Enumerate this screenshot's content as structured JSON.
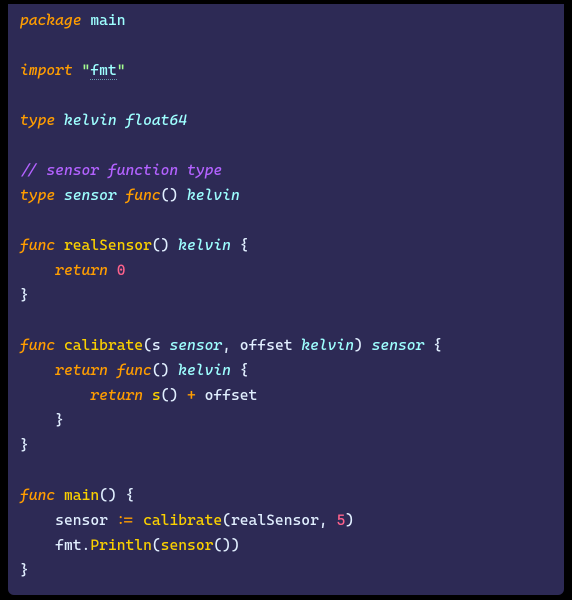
{
  "code": {
    "line1": {
      "kw": "package",
      "id": "main"
    },
    "line2": {
      "kw": "import",
      "q1": "\"",
      "pkg": "fmt",
      "q2": "\""
    },
    "line3": {
      "kw": "type",
      "name": "kelvin",
      "base": "float64"
    },
    "line4": {
      "cm": "// sensor function type"
    },
    "line5": {
      "kw": "type",
      "name": "sensor",
      "fkw": "func",
      "p": "()",
      "ret": "kelvin"
    },
    "line6": {
      "kw": "func",
      "name": "realSensor",
      "p": "()",
      "ret": "kelvin",
      "ob": "{"
    },
    "line7": {
      "indent": "    ",
      "kw": "return",
      "val": "0"
    },
    "line8": {
      "cb": "}"
    },
    "line9": {
      "kw": "func",
      "name": "calibrate",
      "op": "(",
      "a1": "s",
      "t1": "sensor",
      "c": ",",
      "a2": "offset",
      "t2": "kelvin",
      "cp": ")",
      "ret": "sensor",
      "ob": "{"
    },
    "line10": {
      "indent": "    ",
      "kw": "return",
      "fkw": "func",
      "p": "()",
      "ret": "kelvin",
      "ob": "{"
    },
    "line11": {
      "indent": "        ",
      "kw": "return",
      "call": "s",
      "p": "()",
      "op": "+",
      "id": "offset"
    },
    "line12": {
      "indent": "    ",
      "cb": "}"
    },
    "line13": {
      "cb": "}"
    },
    "line14": {
      "kw": "func",
      "name": "main",
      "p": "()",
      "ob": "{"
    },
    "line15": {
      "indent": "    ",
      "id": "sensor",
      "op": ":=",
      "fn": "calibrate",
      "op2": "(",
      "a1": "realSensor",
      "c": ",",
      "a2": "5",
      "cp": ")"
    },
    "line16": {
      "indent": "    ",
      "pkg": "fmt",
      "dot": ".",
      "fn": "Println",
      "op": "(",
      "call": "sensor",
      "p": "()",
      "cp": ")"
    },
    "line17": {
      "cb": "}"
    }
  }
}
